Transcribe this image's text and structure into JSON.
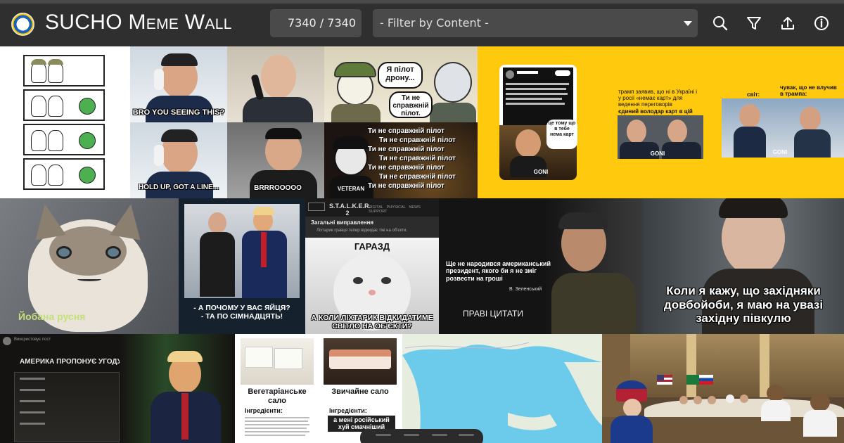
{
  "header": {
    "app_title": "SUCHO Meme Wall",
    "counter": "7340 / 7340",
    "filter_placeholder": "- Filter by Content -",
    "tools": [
      "search-icon",
      "filter-icon",
      "upload-icon",
      "info-icon"
    ]
  },
  "colors": {
    "header_bg": "#2f2f2f",
    "control_bg": "#4a4a4a",
    "yellow_panel": "#ffc90e",
    "map_sea": "#69c7e8"
  },
  "memes": {
    "xi_top": "BRO YOU SEEING THIS?",
    "xi_bottom": "HOLD UP, GOT A LINE...",
    "kim": "BRRROOOOO",
    "drone_bubble_1": "Я пілот дрону...",
    "drone_bubble_2": "Ти не справжній пілот.",
    "veteran_lines": [
      "Ти не справжній пілот",
      "Ти не справжній пілот",
      "Ти не справжній пілот",
      "Ти не справжній пілот",
      "Ти не справжній пілот",
      "Ти не справжній пілот",
      "Ти не справжній пілот"
    ],
    "veteran_label": "VETERAN",
    "musk_caption": "це тому що в тебе нема карт",
    "musk_badge": "GONI",
    "trump_yellow_text": "трамп заявив, що ні в Україні і у росії «немає карт» для ведення переговорів",
    "trump_yellow_sub": "єдиний володар карт в цій війні:",
    "svit": "світ:",
    "chuvak": "чувак, що не влучив в трампа:",
    "grumpy": "Йобана русня",
    "trump_zelensky_caption": "- А ПОЧОМУ У ВАС ЯЙЦЯ?\n- ТА ПО СІМНАДЦЯТЬ!",
    "stalker_title": "S.T.A.L.K.E.R. 2",
    "stalker_nav": [
      "DIGITAL",
      "PHYSICAL",
      "NEWS",
      "SUPPORT"
    ],
    "stalker_section": "Загальні виправлення",
    "stalker_note": "Ліхтарик гравця тепер відкидає тіні на об'єкти.",
    "garazd": "ГАРАЗД",
    "stalker_bottom": "А КОЛИ ЛІХТАРИК ВІДКИДАТИМЕ СВІТЛО НА ОБ'ЄКТИ?",
    "zelensky_quote": "Ще не народився американський президент, якого би я не зміг розвести на гроші",
    "zelensky_sig": "В. Зеленський",
    "pravi_tsytaty": "ПРАВІ ЦИТАТИ",
    "shelby": "Коли я кажу, що західняки довбойоби, я маю на увазі західну півкулю",
    "america_title": "АМЕРИКА ПРОПОНУЄ УГОДУ",
    "america_top": "Використовує пост",
    "salo_left": "Вегетаріанське сало",
    "salo_right": "Звичайне сало",
    "ingredients": "Інгредієнти:",
    "salo_bottom": "а мені російський хуй смачніший"
  }
}
